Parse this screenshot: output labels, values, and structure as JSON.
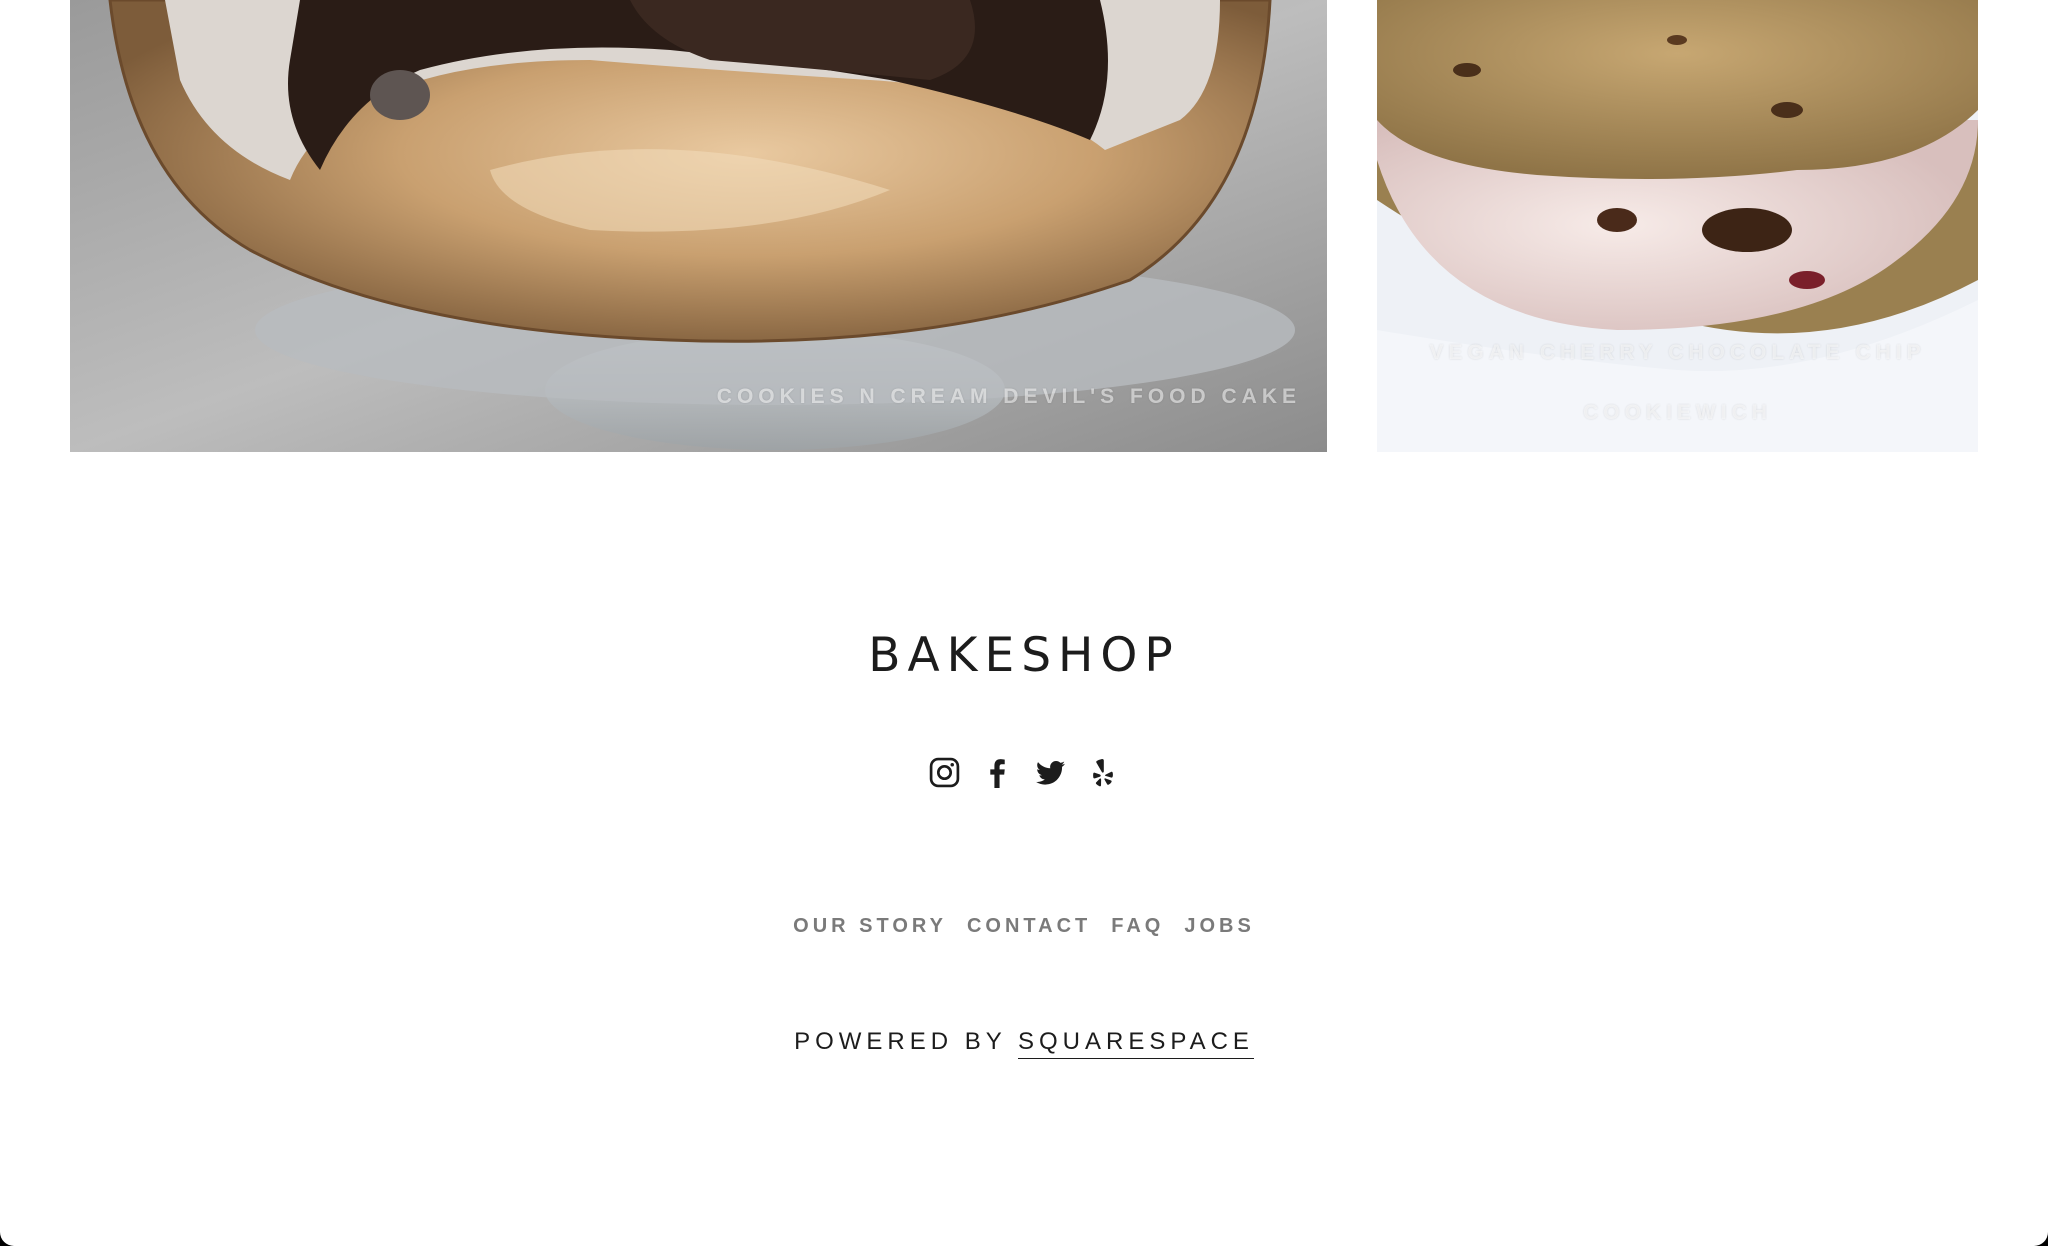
{
  "gallery": {
    "items": [
      {
        "caption": "Cookies N Cream Devil's Food Cake"
      },
      {
        "caption": "Vegan Cherry Chocolate Chip Cookiewich"
      }
    ]
  },
  "footer": {
    "brand": "BAKESHOP",
    "social": [
      {
        "icon": "instagram-icon"
      },
      {
        "icon": "facebook-icon"
      },
      {
        "icon": "twitter-icon"
      },
      {
        "icon": "yelp-icon"
      }
    ],
    "nav": [
      {
        "label": "OUR STORY"
      },
      {
        "label": "CONTACT"
      },
      {
        "label": "FAQ"
      },
      {
        "label": "JOBS"
      }
    ],
    "powered_by_prefix": "POWERED BY",
    "powered_by_link": "SQUARESPACE"
  },
  "colors": {
    "text_dark": "#1c1c1c",
    "nav_gray": "#7a7a7a",
    "background": "#ffffff"
  }
}
